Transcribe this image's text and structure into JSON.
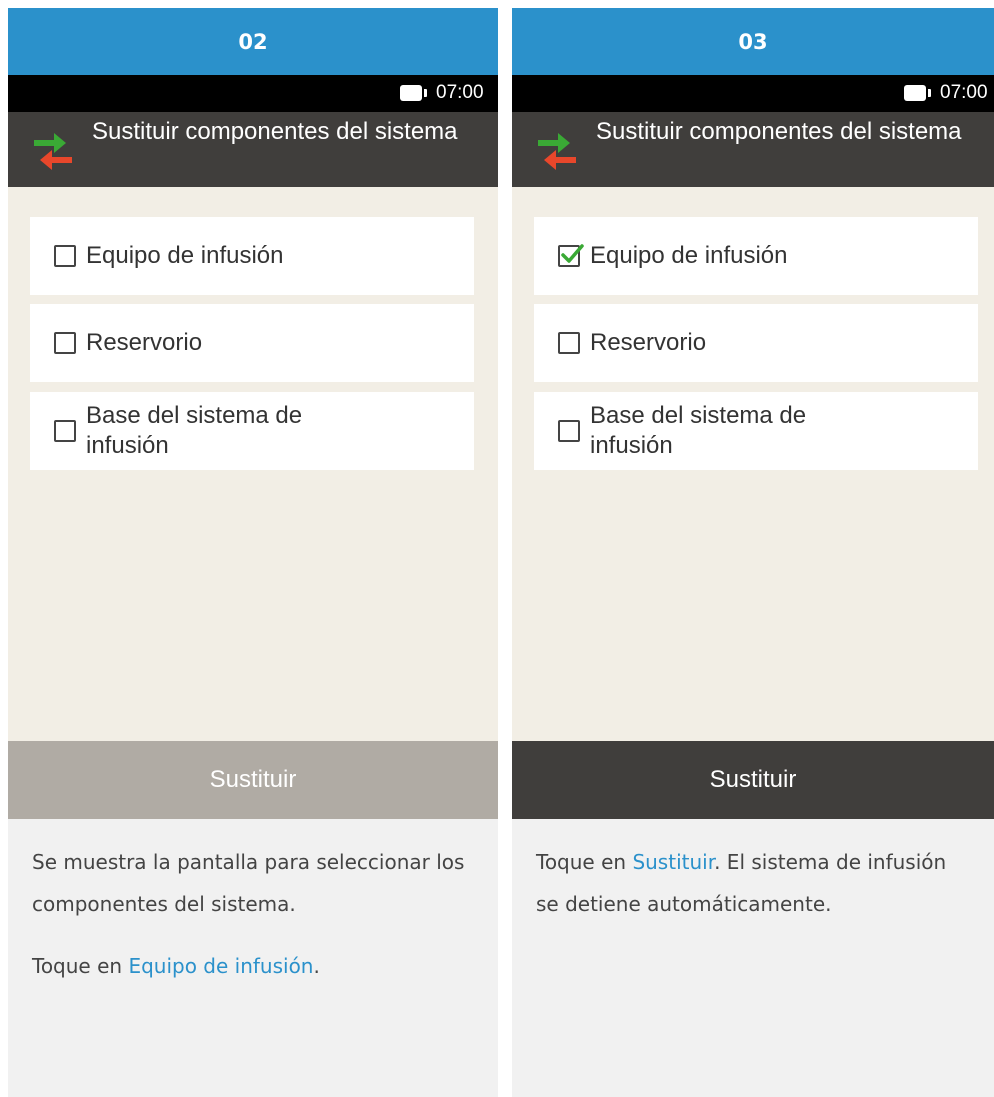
{
  "colors": {
    "step_header": "#2b91cb",
    "title_bar": "#403e3c",
    "content_bg": "#f2eee5",
    "button_disabled": "#b0aba4",
    "button_enabled": "#403e3c",
    "link": "#2b91cb",
    "arrow_green": "#3aa935",
    "arrow_red": "#e8472b"
  },
  "panels": [
    {
      "step": "02",
      "status": {
        "battery_icon": "battery-icon",
        "time": "07:00"
      },
      "title": "Sustituir componentes del sistema",
      "title_icon": "swap-arrows-icon",
      "items": [
        {
          "label": "Equipo de infusión",
          "checked": false
        },
        {
          "label": "Reservorio",
          "checked": false
        },
        {
          "label": "Base del sistema de infusión",
          "checked": false
        }
      ],
      "button": {
        "label": "Sustituir",
        "enabled": false
      },
      "description": {
        "p1": "Se muestra la pantalla para seleccionar los componentes del sistema.",
        "p2_prefix": "Toque en ",
        "p2_link": "Equipo de infusión",
        "p2_suffix": "."
      }
    },
    {
      "step": "03",
      "status": {
        "battery_icon": "battery-icon",
        "time": "07:00"
      },
      "title": "Sustituir componentes del sistema",
      "title_icon": "swap-arrows-icon",
      "items": [
        {
          "label": "Equipo de infusión",
          "checked": true
        },
        {
          "label": "Reservorio",
          "checked": false
        },
        {
          "label": "Base del sistema de infusión",
          "checked": false
        }
      ],
      "button": {
        "label": "Sustituir",
        "enabled": true
      },
      "description": {
        "p1_prefix": "Toque en ",
        "p1_link": "Sustituir",
        "p1_suffix": ". El sistema de infusión se detiene automáticamente."
      }
    }
  ]
}
